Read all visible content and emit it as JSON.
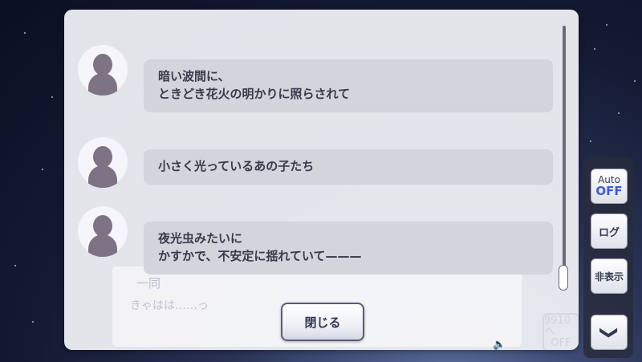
{
  "log": {
    "entries": [
      {
        "lines": [
          "暗い波間に、",
          "ときどき花火の明かりに照らされて"
        ]
      },
      {
        "lines": [
          "小さく光っているあの子たち"
        ]
      },
      {
        "lines": [
          "夜光虫みたいに",
          "かすかで、不安定に揺れていて———"
        ]
      }
    ],
    "close_label": "閉じる"
  },
  "background_textbox": {
    "speaker": "一同",
    "line": "きゃはは……っ",
    "auto_top": "9910へ",
    "auto_bottom": "OFF"
  },
  "side_menu": {
    "auto_top": "Auto",
    "auto_bottom": "OFF",
    "log_label": "ログ",
    "hide_label": "非表示",
    "chevron_glyph": "❯"
  },
  "colors": {
    "bubble": "#d2d5dc",
    "avatar_silhouette": "#7e7384",
    "auto_off_accent": "#3e5bd6"
  }
}
